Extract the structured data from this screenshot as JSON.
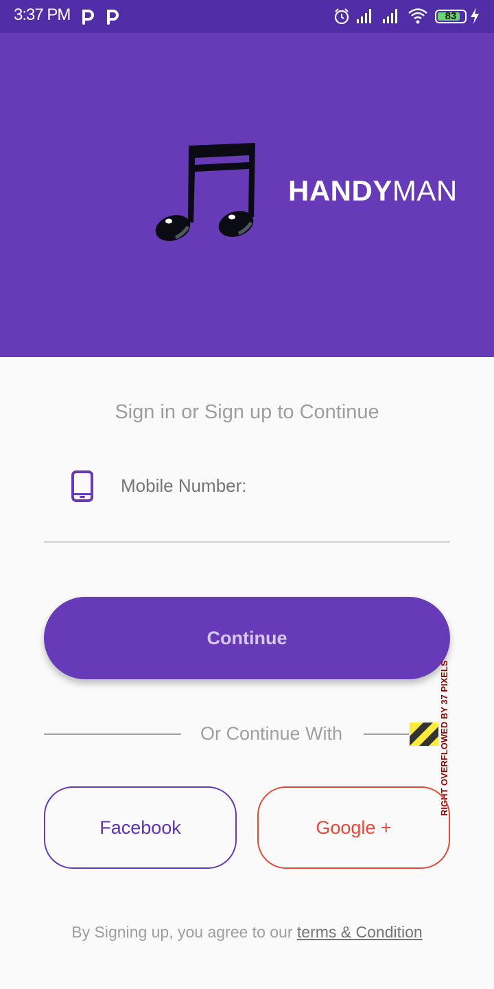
{
  "status_bar": {
    "time": "3:37 PM",
    "battery_level": "83",
    "battery_fraction": 0.83,
    "icons": [
      "p-icon",
      "p-icon",
      "alarm-icon",
      "signal-icon",
      "signal-icon",
      "wifi-icon",
      "battery-icon",
      "charging-icon"
    ]
  },
  "header": {
    "logo_icon": "music-note-icon",
    "brand_bold": "HANDY",
    "brand_regular": "MAN",
    "background": "#673ab7"
  },
  "signin": {
    "subtitle": "Sign in or Sign up to Continue",
    "mobile_label": "Mobile Number:",
    "mobile_icon": "smartphone-icon"
  },
  "continue_button": {
    "label": "Continue",
    "color": "#673ab7"
  },
  "divider": {
    "label": "Or Continue With"
  },
  "overflow_warning": {
    "text": "RIGHT OVERFLOWED BY 37 PIXELS"
  },
  "social": {
    "facebook_label": "Facebook",
    "google_label": "Google +",
    "facebook_color": "#673ab7",
    "google_color": "#e04b3c"
  },
  "footer": {
    "terms_prefix": "By Signing up, you agree to our ",
    "terms_link": "terms & Condition"
  }
}
